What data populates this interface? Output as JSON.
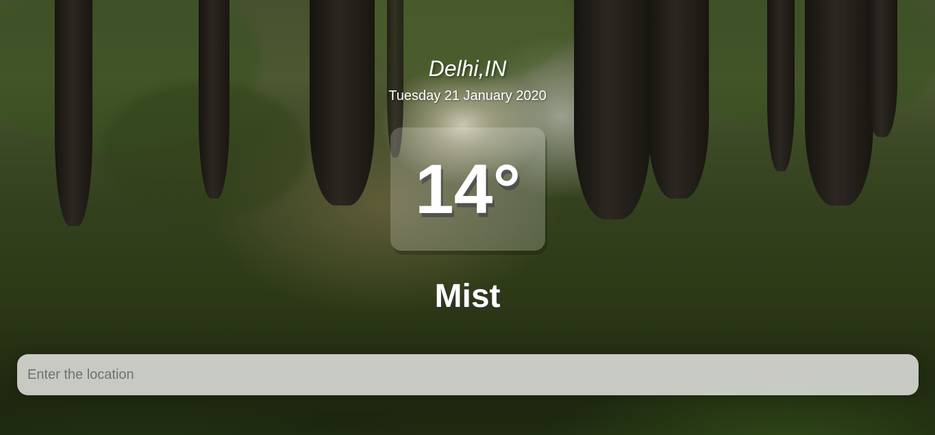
{
  "location": "Delhi,IN",
  "date": "Tuesday 21 January 2020",
  "temperature": "14°",
  "weather": "Mist",
  "search": {
    "placeholder": "Enter the location",
    "value": ""
  },
  "background": {
    "scene": "forest with sunlight and moss"
  }
}
